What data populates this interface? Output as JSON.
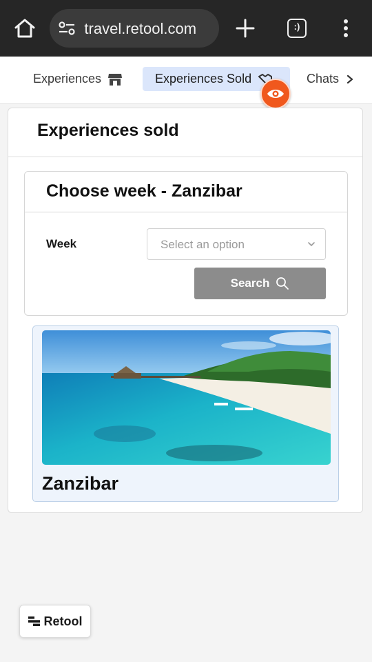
{
  "browser": {
    "url": " travel.retool.com",
    "tab_count_glyph": ":)"
  },
  "nav": {
    "items": [
      {
        "label": "Experiences",
        "icon": "store-icon"
      },
      {
        "label": "Experiences Sold",
        "icon": "handshake-icon",
        "active": true
      },
      {
        "label": "Chats",
        "icon": "chevron-right-icon"
      }
    ],
    "fab_icon": "eye-icon"
  },
  "main": {
    "title": "Experiences sold",
    "week_card": {
      "title": "Choose week - Zanzibar",
      "week_label": "Week",
      "select_placeholder": "Select an option",
      "search_label": "Search"
    },
    "destination": {
      "name": "Zanzibar",
      "image": "beach-photo"
    }
  },
  "badge": {
    "label": "Retool"
  },
  "colors": {
    "accent_orange": "#f0581d",
    "active_tab_bg": "#dbe6fb",
    "search_button": "#8c8c8c",
    "browser_bar": "#262626"
  }
}
